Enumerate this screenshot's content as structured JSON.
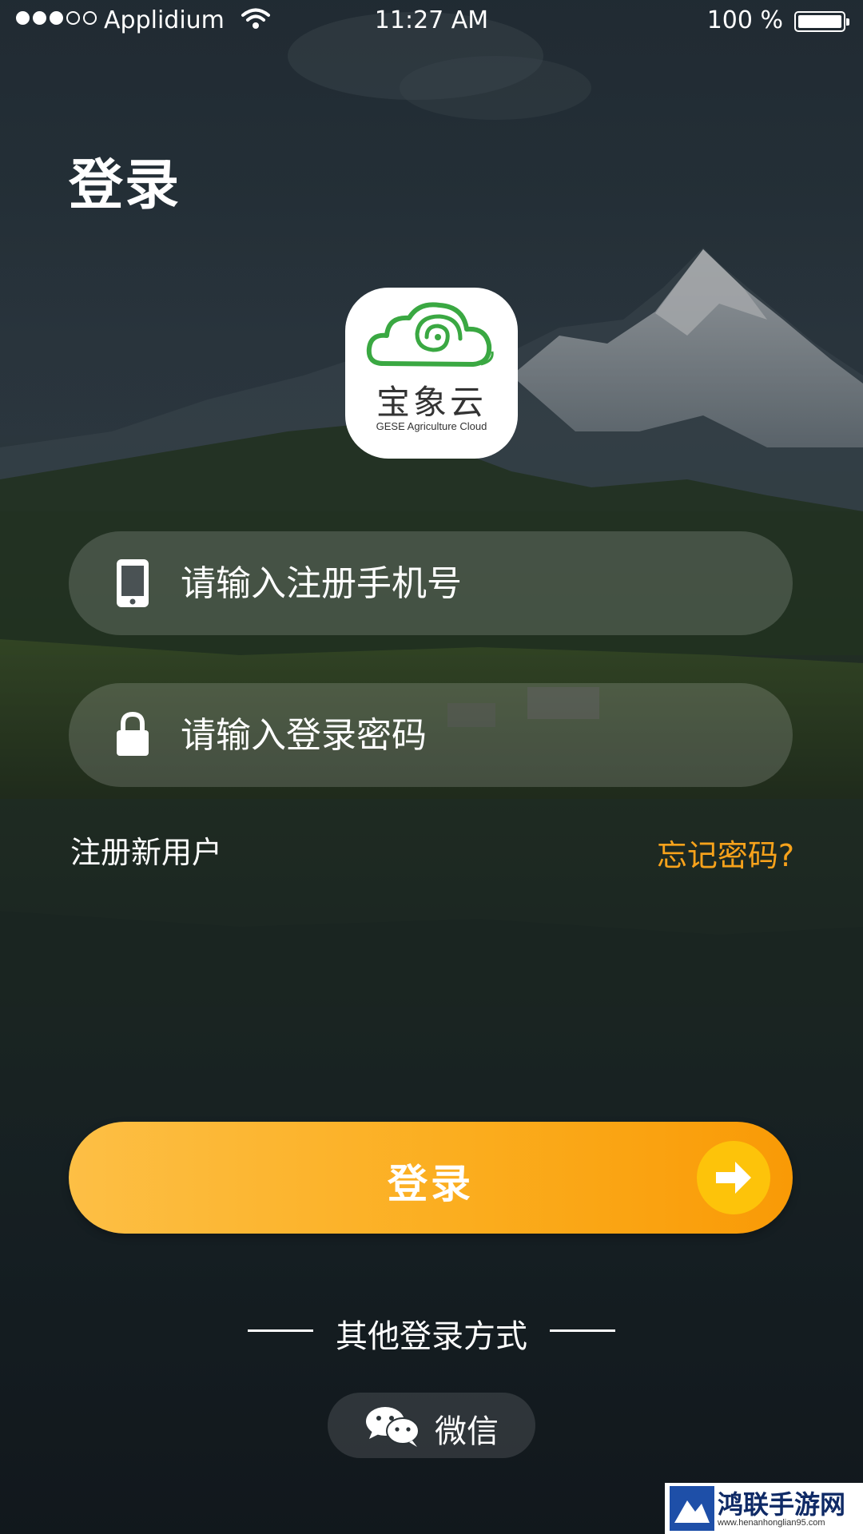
{
  "status_bar": {
    "carrier": "Applidium",
    "time": "11:27 AM",
    "battery": "100 %"
  },
  "page": {
    "title": "登录"
  },
  "logo": {
    "chinese_name": "宝象云",
    "english_name": "GESE Agriculture Cloud"
  },
  "form": {
    "phone_placeholder": "请输入注册手机号",
    "password_placeholder": "请输入登录密码",
    "register_link": "注册新用户",
    "forgot_link": "忘记密码?"
  },
  "login_button": {
    "label": "登录"
  },
  "other_login": {
    "label": "其他登录方式",
    "wechat_label": "微信"
  },
  "watermark": {
    "text": "鸿联手游网",
    "url": "www.henanhonglian95.com"
  },
  "colors": {
    "accent_orange": "#f7a21b",
    "button_start": "#fdbf45",
    "button_end": "#f99a06",
    "arrow_circle": "#fdc30a",
    "logo_green": "#3aa842"
  }
}
